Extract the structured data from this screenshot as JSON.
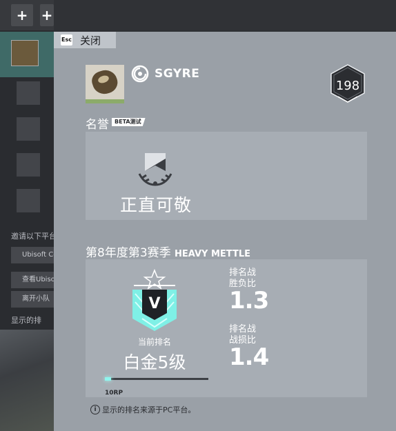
{
  "background": {
    "invite_text": "邀请以下平台",
    "buttons": [
      "Ubisoft Conn",
      "查看Ubiso",
      "离开小队"
    ],
    "info_text": "显示的排"
  },
  "overlay": {
    "close": {
      "key": "Esc",
      "label": "关闭"
    },
    "profile": {
      "username": "SGYRE",
      "level": "198",
      "avatar_icon": "avatar-image",
      "platform_icon": "ubisoft-icon"
    },
    "honor": {
      "title": "名誉",
      "beta_tag": "BETA测试",
      "icon": "honor-badge-icon",
      "name": "正直可敬"
    },
    "season": {
      "title": "第8年度第3赛季",
      "name": "HEAVY METTLE",
      "current_rank_label": "当前排名",
      "current_rank": "白金5级",
      "rank_emblem_letter": "V",
      "stats": [
        {
          "label_line1": "排名战",
          "label_line2": "胜负比",
          "value": "1.3"
        },
        {
          "label_line1": "排名战",
          "label_line2": "战损比",
          "value": "1.4"
        }
      ],
      "rp_label": "10RP",
      "rp_progress": 0.06
    },
    "note": "显示的排名来源于PC平台。"
  },
  "colors": {
    "panel": "#9aa0a7",
    "card": "#a7adb4",
    "accent_teal": "#8ff5ee",
    "emblem_dark": "#2a2c30"
  }
}
